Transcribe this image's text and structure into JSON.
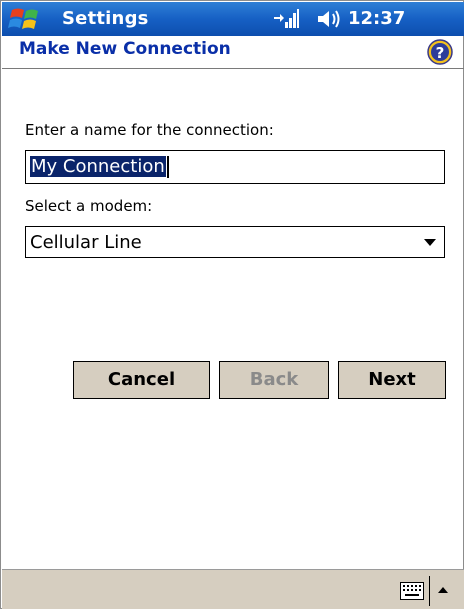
{
  "titlebar": {
    "app_title": "Settings",
    "clock": "12:37",
    "icons": [
      "windows-start-icon",
      "signal-icon",
      "volume-icon"
    ]
  },
  "header": {
    "page_title": "Make New Connection",
    "help_icon": "help-icon"
  },
  "form": {
    "name_label": "Enter a name for the connection:",
    "name_value": "My Connection",
    "modem_label": "Select a modem:",
    "modem_value": "Cellular Line"
  },
  "buttons": {
    "cancel": "Cancel",
    "back": "Back",
    "next": "Next"
  },
  "bottom_bar": {
    "icons": [
      "keyboard-icon",
      "input-menu-arrow-icon"
    ]
  },
  "colors": {
    "title_bar": "#1660c4",
    "page_title": "#0a2fa8",
    "button_face": "#d6cec0",
    "selection": "#0a246a"
  }
}
